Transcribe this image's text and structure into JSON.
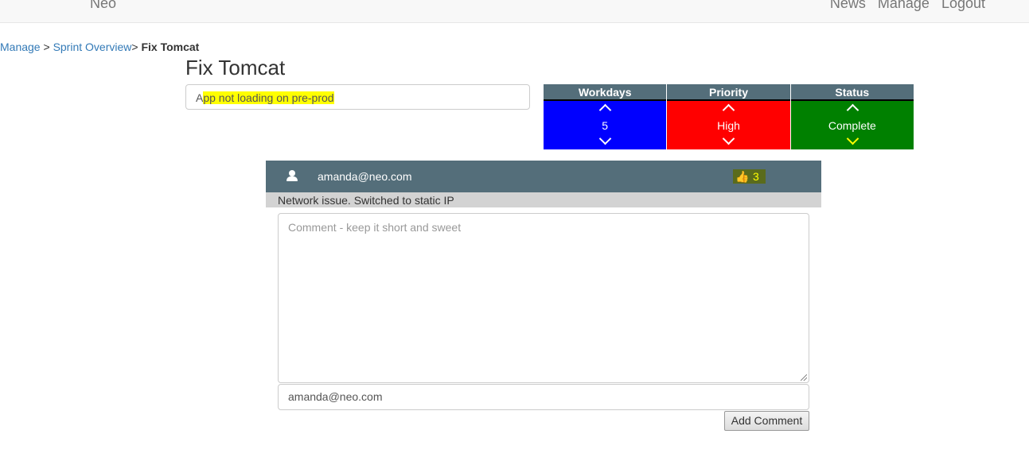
{
  "navbar": {
    "brand": "Neo",
    "links": [
      "News",
      "Manage",
      "Logout"
    ]
  },
  "breadcrumb": {
    "items": [
      "Manage",
      "Sprint Overview"
    ],
    "sep1": " > ",
    "sep2": "> ",
    "current": "Fix Tomcat"
  },
  "task": {
    "title": "Fix Tomcat",
    "description_first": "A",
    "description_rest": "pp not loading on pre-prod"
  },
  "attributes": {
    "workdays": {
      "label": "Workdays",
      "value": "5",
      "color": "#0000ff"
    },
    "priority": {
      "label": "Priority",
      "value": "High",
      "color": "#ff0000"
    },
    "status": {
      "label": "Status",
      "value": "Complete",
      "color": "#008000"
    }
  },
  "comment": {
    "user": "amanda@neo.com",
    "likes": "3",
    "text": "Network issue. Switched to static IP",
    "header_color": "#546e7a"
  },
  "form": {
    "comment_placeholder": "Comment - keep it short and sweet",
    "author_value": "amanda@neo.com",
    "submit_label": "Add Comment"
  }
}
